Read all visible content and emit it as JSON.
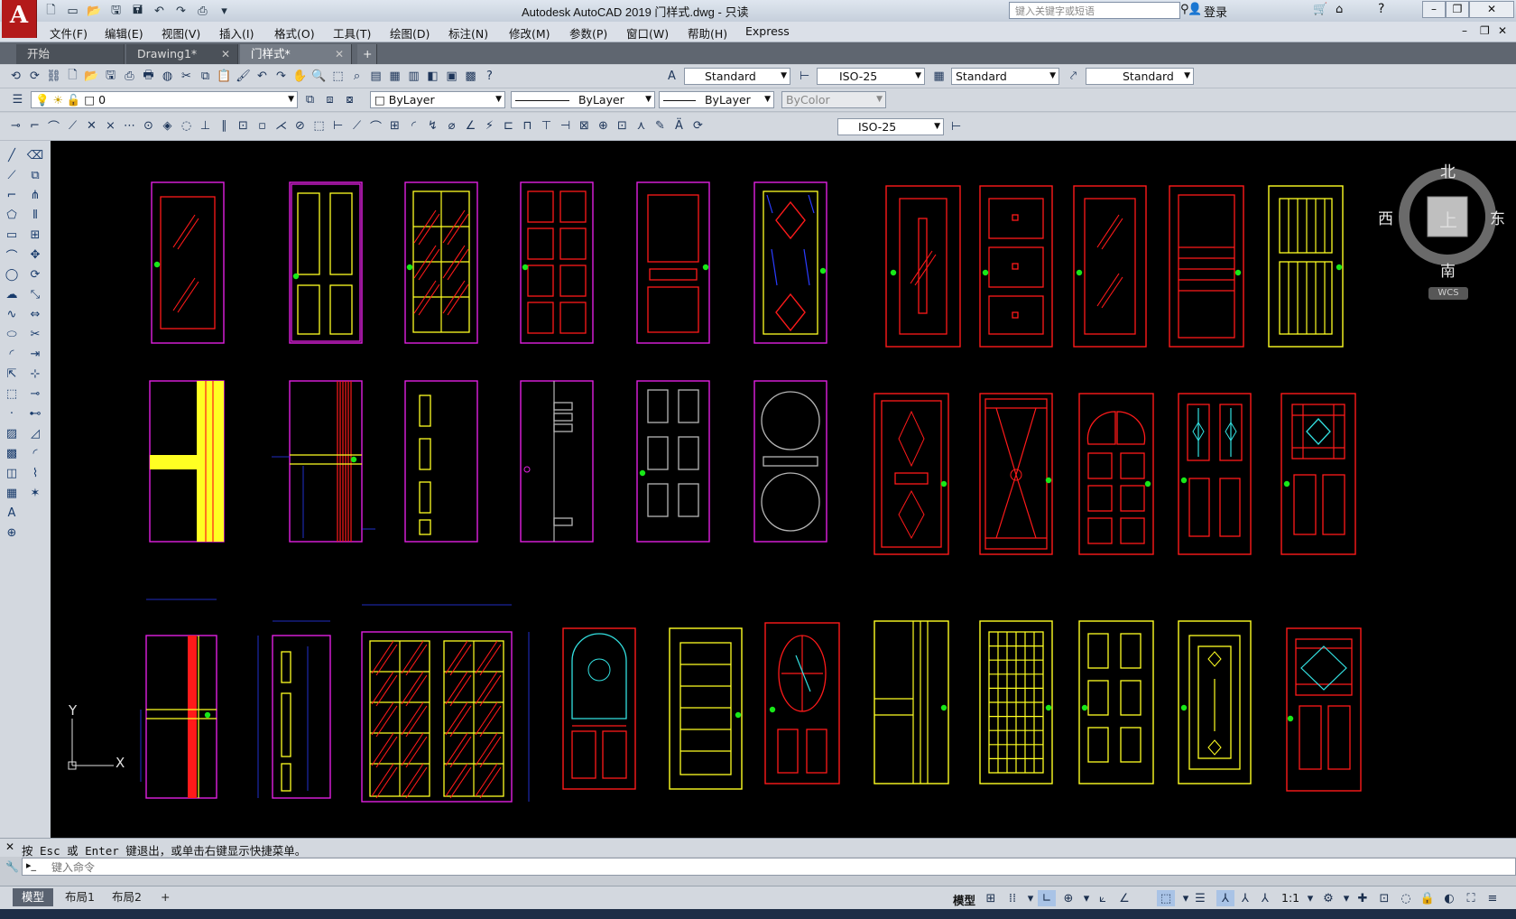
{
  "app": {
    "title": "Autodesk AutoCAD 2019    门样式.dwg - 只读",
    "logo": "A",
    "search_placeholder": "键入关键字或短语",
    "login_label": "登录"
  },
  "menu": [
    "文件(F)",
    "编辑(E)",
    "视图(V)",
    "插入(I)",
    "格式(O)",
    "工具(T)",
    "绘图(D)",
    "标注(N)",
    "修改(M)",
    "参数(P)",
    "窗口(W)",
    "帮助(H)",
    "Express"
  ],
  "tabs": [
    {
      "label": "开始",
      "active": false,
      "closable": false
    },
    {
      "label": "Drawing1*",
      "active": false,
      "closable": true
    },
    {
      "label": "门样式*",
      "active": true,
      "closable": true
    }
  ],
  "toolbar1": {
    "text_style": "Standard",
    "dim_style": "ISO-25",
    "table_style": "Standard",
    "mleader_style": "Standard"
  },
  "toolbar2": {
    "layer": "0",
    "color": "ByLayer",
    "linetype": "ByLayer",
    "lineweight": "ByLayer",
    "plotstyle": "ByColor"
  },
  "toolbar3": {
    "dim_style": "ISO-25"
  },
  "viewcube": {
    "north": "北",
    "south": "南",
    "east": "东",
    "west": "西",
    "top": "上",
    "wcs": "WCS"
  },
  "ucs": {
    "x": "X",
    "y": "Y"
  },
  "command": {
    "history": "按 Esc 或 Enter 键退出，或单击右键显示快捷菜单。",
    "input_placeholder": "键入命令"
  },
  "layouts": [
    "模型",
    "布局1",
    "布局2"
  ],
  "status": {
    "model_label": "模型",
    "scale": "1:1"
  },
  "colors": {
    "magenta": "#e020e0",
    "red": "#ff1a1a",
    "yellow": "#ffff22",
    "blue": "#2a3cff",
    "green": "#18e818",
    "cyan": "#33e0e0",
    "gray": "#b5b5b5"
  }
}
